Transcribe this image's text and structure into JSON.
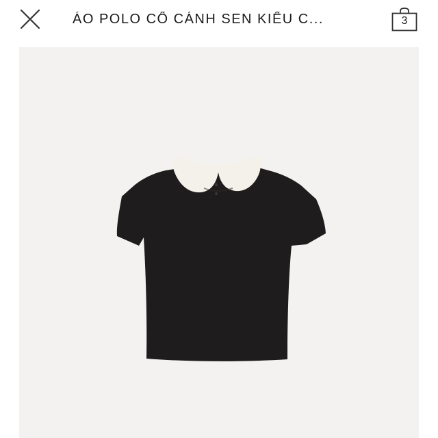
{
  "header": {
    "close_icon": "close-icon",
    "title": "ÁO POLO CỔ CÁNH SEN KIỂU C...",
    "bag_icon": "shopping-bag-icon",
    "bag_count": "3"
  },
  "product_image": {
    "alt": "Black short-sleeve top with white Peter Pan collar",
    "colors": {
      "background": "#f3f2f0",
      "garment": "#1e1c1c",
      "collar": "#f4f1ea"
    }
  }
}
